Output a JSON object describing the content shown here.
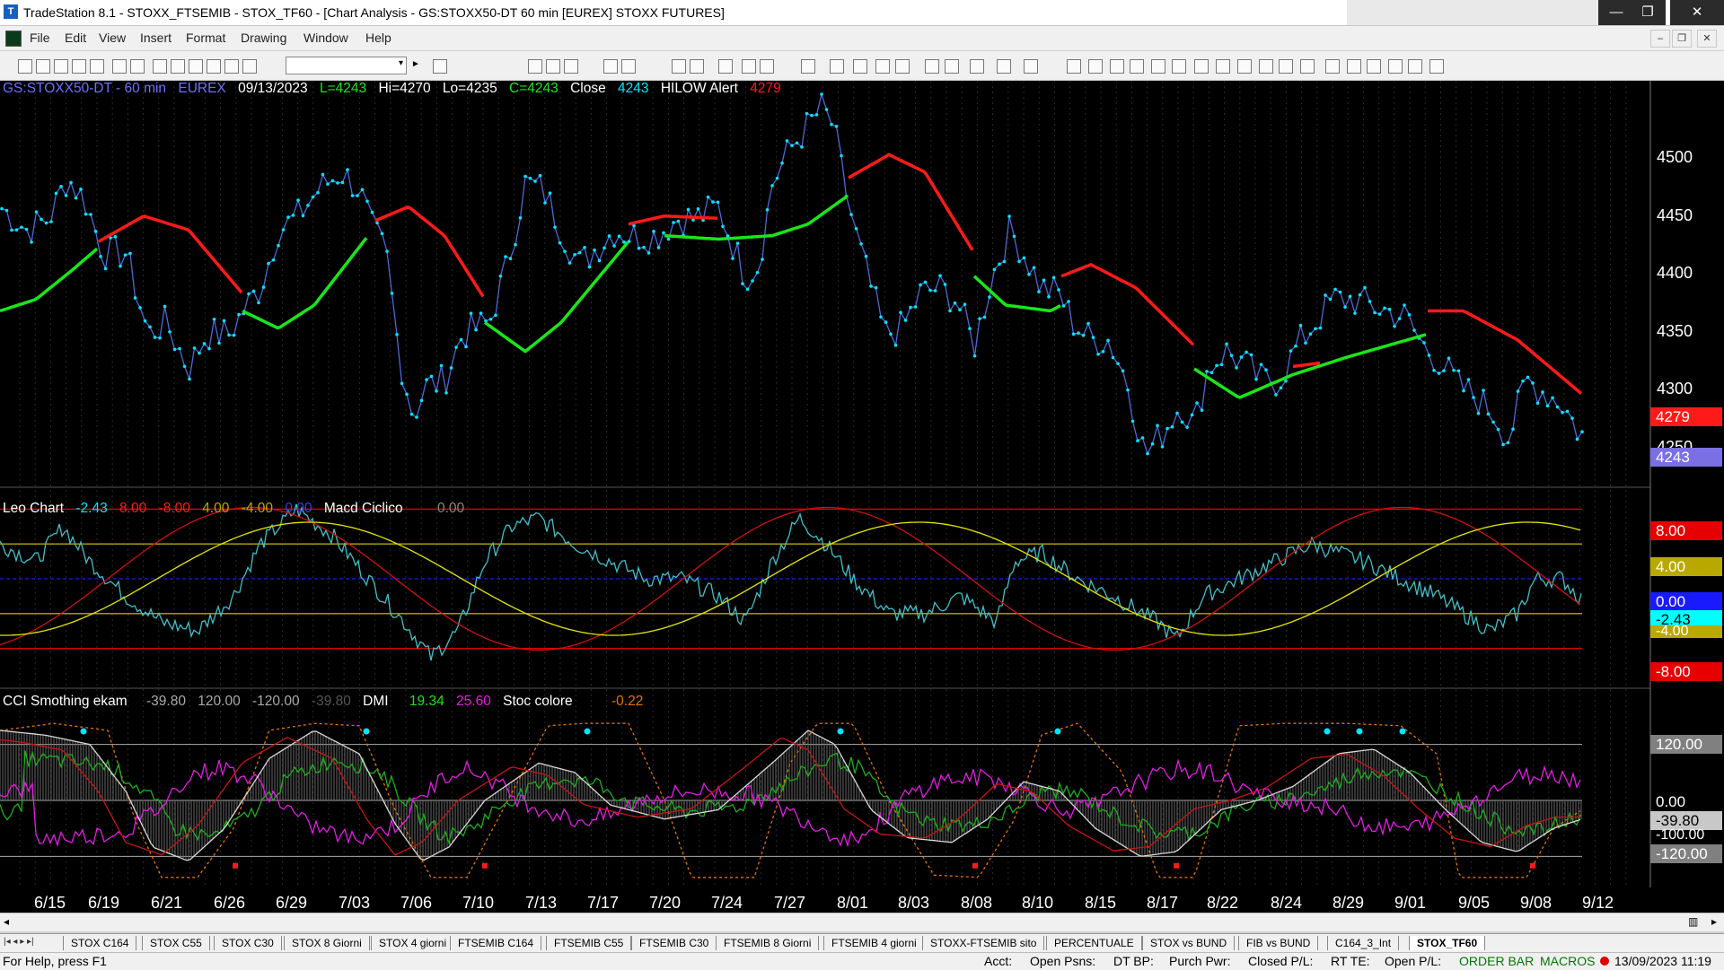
{
  "window": {
    "title": "TradeStation 8.1 - STOXX_FTSEMIB - STOX_TF60 - [Chart Analysis - GS:STOXX50-DT  60 min  [EUREX] STOXX FUTURES]",
    "min_label": "—",
    "max_label": "❐",
    "close_label": "✕"
  },
  "menu": {
    "items": [
      "File",
      "Edit",
      "View",
      "Insert",
      "Format",
      "Drawing",
      "Window",
      "Help"
    ],
    "mdi_buttons": [
      "–",
      "❐",
      "✕"
    ]
  },
  "toolbar": {
    "combo_arrow": "▾",
    "go_arrow": "►"
  },
  "chart": {
    "header": {
      "symbol": "GS:STOXX50-DT - 60 min",
      "exchange": "EUREX",
      "date": "09/13/2023",
      "last": "L=4243",
      "high": "Hi=4270",
      "low": "Lo=4235",
      "close_value": "C=4243",
      "close_label": "Close",
      "close_num": "4243",
      "alert_label": "HILOW Alert",
      "alert_num": "4279"
    },
    "price_axis": [
      "4500",
      "4450",
      "4400",
      "4350",
      "4300",
      "4250"
    ],
    "price_boxes": {
      "alert": "4279",
      "last": "4243"
    },
    "colors": {
      "bg": "#000000",
      "price": "#00e5ff",
      "wave_up": "#19e619",
      "wave_down": "#ff1a1a",
      "yellow": "#e6e600",
      "magenta": "#e61ae6",
      "cyan_dim": "#40c0c8"
    },
    "leo": {
      "title": "Leo Chart",
      "values": [
        "-2.43",
        "8.00",
        "-8.00",
        "4.00",
        "-4.00",
        "0.00"
      ],
      "macd_label": "Macd Ciclico",
      "macd_value": "0.00",
      "axis_boxes": [
        "8.00",
        "4.00",
        "0.00",
        "-2.43",
        "-4.00",
        "-8.00"
      ]
    },
    "cci": {
      "title": "CCI Smothing ekam",
      "values": [
        "-39.80",
        "120.00",
        "-120.00",
        "-39.80"
      ],
      "dmi_label": "DMI",
      "dmi_values": [
        "19.34",
        "25.60"
      ],
      "stoc_label": "Stoc colore",
      "stoc_value": "-0.22",
      "axis_boxes": [
        "120.00",
        "0.00",
        "-39.80",
        "-120.00"
      ],
      "extra_axis": "-100.00"
    },
    "dates": [
      "6/15",
      "6/19",
      "6/21",
      "6/26",
      "6/29",
      "7/03",
      "7/06",
      "7/10",
      "7/13",
      "7/17",
      "7/20",
      "7/24",
      "7/27",
      "8/01",
      "8/03",
      "8/08",
      "8/10",
      "8/15",
      "8/17",
      "8/22",
      "8/24",
      "8/29",
      "9/01",
      "9/05",
      "9/08",
      "9/12"
    ]
  },
  "tabs": [
    "STOX C164",
    "STOX C55",
    "STOX C30",
    "STOX 8 Giorni",
    "STOX 4 giorni",
    "FTSEMIB C164",
    "FTSEMIB C55",
    "FTSEMIB C30",
    "FTSEMIB 8 Giorni",
    "FTSEMIB 4 giorni",
    "STOXX-FTSEMIB sito",
    "PERCENTUALE",
    "STOX vs BUND",
    "FIB vs BUND",
    "C164_3_Int",
    "STOX_TF60"
  ],
  "status": {
    "help": "For Help, press F1",
    "acct": "Acct:",
    "open_psns": "Open Psns:",
    "dt_bp": "DT BP:",
    "purch_pwr": "Purch Pwr:",
    "closed_pl": "Closed P/L:",
    "rt_te": "RT TE:",
    "open_pl": "Open P/L:",
    "order_bar": "ORDER BAR",
    "macros": "MACROS",
    "datetime": "13/09/2023 11:19"
  }
}
